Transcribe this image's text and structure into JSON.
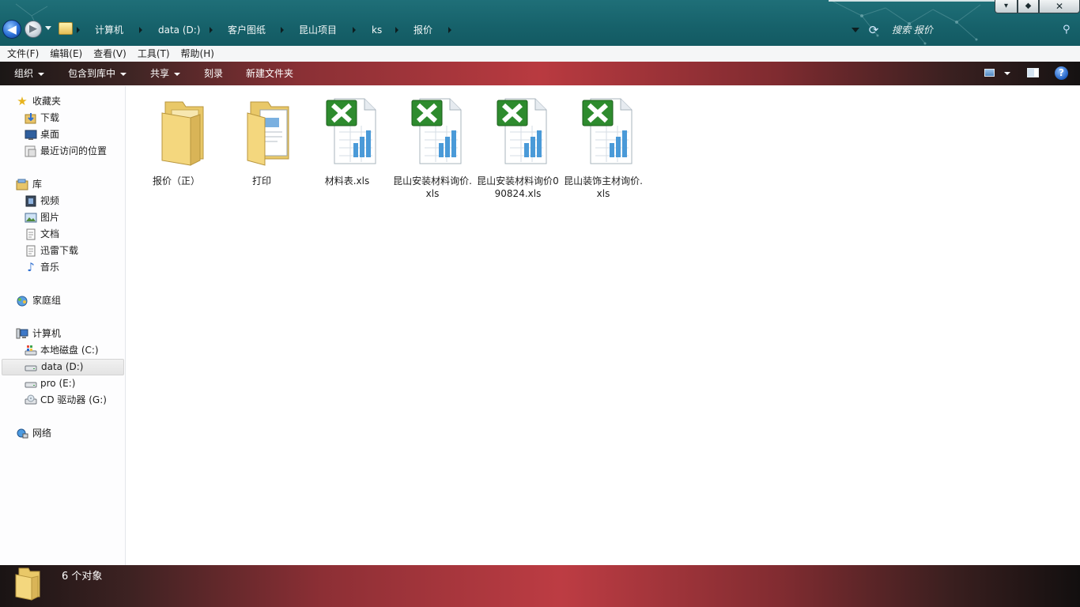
{
  "window": {
    "breadcrumb": [
      "计算机",
      "data (D:)",
      "客户图纸",
      "昆山项目",
      "ks",
      "报价"
    ],
    "search_placeholder": "搜索 报价",
    "controls": {
      "minimize": "▾",
      "maximize": "◆",
      "close": "✕"
    }
  },
  "menubar": {
    "items": [
      "文件(F)",
      "编辑(E)",
      "查看(V)",
      "工具(T)",
      "帮助(H)"
    ]
  },
  "commandbar": {
    "organize": "组织",
    "include_in_library": "包含到库中",
    "share": "共享",
    "burn": "刻录",
    "new_folder": "新建文件夹",
    "help": "?"
  },
  "navpane": {
    "favorites": {
      "label": "收藏夹",
      "items": [
        "下载",
        "桌面",
        "最近访问的位置"
      ]
    },
    "libraries": {
      "label": "库",
      "items": [
        "视频",
        "图片",
        "文档",
        "迅雷下载",
        "音乐"
      ]
    },
    "homegroup": {
      "label": "家庭组"
    },
    "computer": {
      "label": "计算机",
      "items": [
        "本地磁盘 (C:)",
        "data (D:)",
        "pro (E:)",
        "CD 驱动器 (G:)"
      ]
    },
    "network": {
      "label": "网络"
    }
  },
  "files": [
    {
      "name": "报价（正）",
      "type": "folder"
    },
    {
      "name": "打印",
      "type": "folder-docs"
    },
    {
      "name": "材料表.xls",
      "type": "excel"
    },
    {
      "name": "昆山安装材料询价.xls",
      "type": "excel"
    },
    {
      "name": "昆山安装材料询价090824.xls",
      "type": "excel"
    },
    {
      "name": "昆山装饰主材询价.xls",
      "type": "excel"
    }
  ],
  "status": {
    "count_text": "6 个对象"
  },
  "colors": {
    "titlebar": "#16616a",
    "command_bar_accent": "#b93a40",
    "excel_green": "#2e8b2e"
  }
}
